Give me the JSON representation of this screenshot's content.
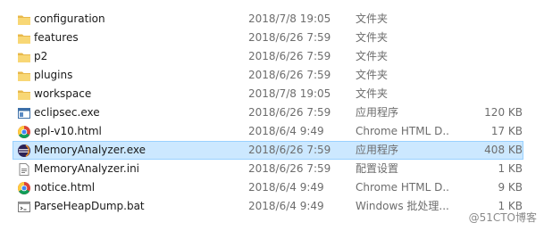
{
  "file_list": {
    "rows": [
      {
        "icon": "folder-icon",
        "name": "configuration",
        "date": "2018/7/8 19:05",
        "type": "文件夹",
        "size": ""
      },
      {
        "icon": "folder-icon",
        "name": "features",
        "date": "2018/6/26 7:59",
        "type": "文件夹",
        "size": ""
      },
      {
        "icon": "folder-icon",
        "name": "p2",
        "date": "2018/6/26 7:59",
        "type": "文件夹",
        "size": ""
      },
      {
        "icon": "folder-icon",
        "name": "plugins",
        "date": "2018/6/26 7:59",
        "type": "文件夹",
        "size": ""
      },
      {
        "icon": "folder-icon",
        "name": "workspace",
        "date": "2018/7/8 19:05",
        "type": "文件夹",
        "size": ""
      },
      {
        "icon": "app-window-icon",
        "name": "eclipsec.exe",
        "date": "2018/6/26 7:59",
        "type": "应用程序",
        "size": "120 KB"
      },
      {
        "icon": "chrome-icon",
        "name": "epl-v10.html",
        "date": "2018/6/4 9:49",
        "type": "Chrome HTML D...",
        "size": "17 KB"
      },
      {
        "icon": "eclipse-icon",
        "name": "MemoryAnalyzer.exe",
        "date": "2018/6/26 7:59",
        "type": "应用程序",
        "size": "408 KB",
        "selected": true
      },
      {
        "icon": "settings-file-icon",
        "name": "MemoryAnalyzer.ini",
        "date": "2018/6/26 7:59",
        "type": "配置设置",
        "size": "1 KB"
      },
      {
        "icon": "chrome-icon",
        "name": "notice.html",
        "date": "2018/6/4 9:49",
        "type": "Chrome HTML D...",
        "size": "9 KB"
      },
      {
        "icon": "batch-file-icon",
        "name": "ParseHeapDump.bat",
        "date": "2018/6/4 9:49",
        "type": "Windows 批处理...",
        "size": "1 KB"
      }
    ]
  },
  "colors": {
    "selection_background": "#cce8ff",
    "selection_border": "#99d1ff",
    "folder": "#f8d775"
  },
  "watermark": "@51CTO博客"
}
